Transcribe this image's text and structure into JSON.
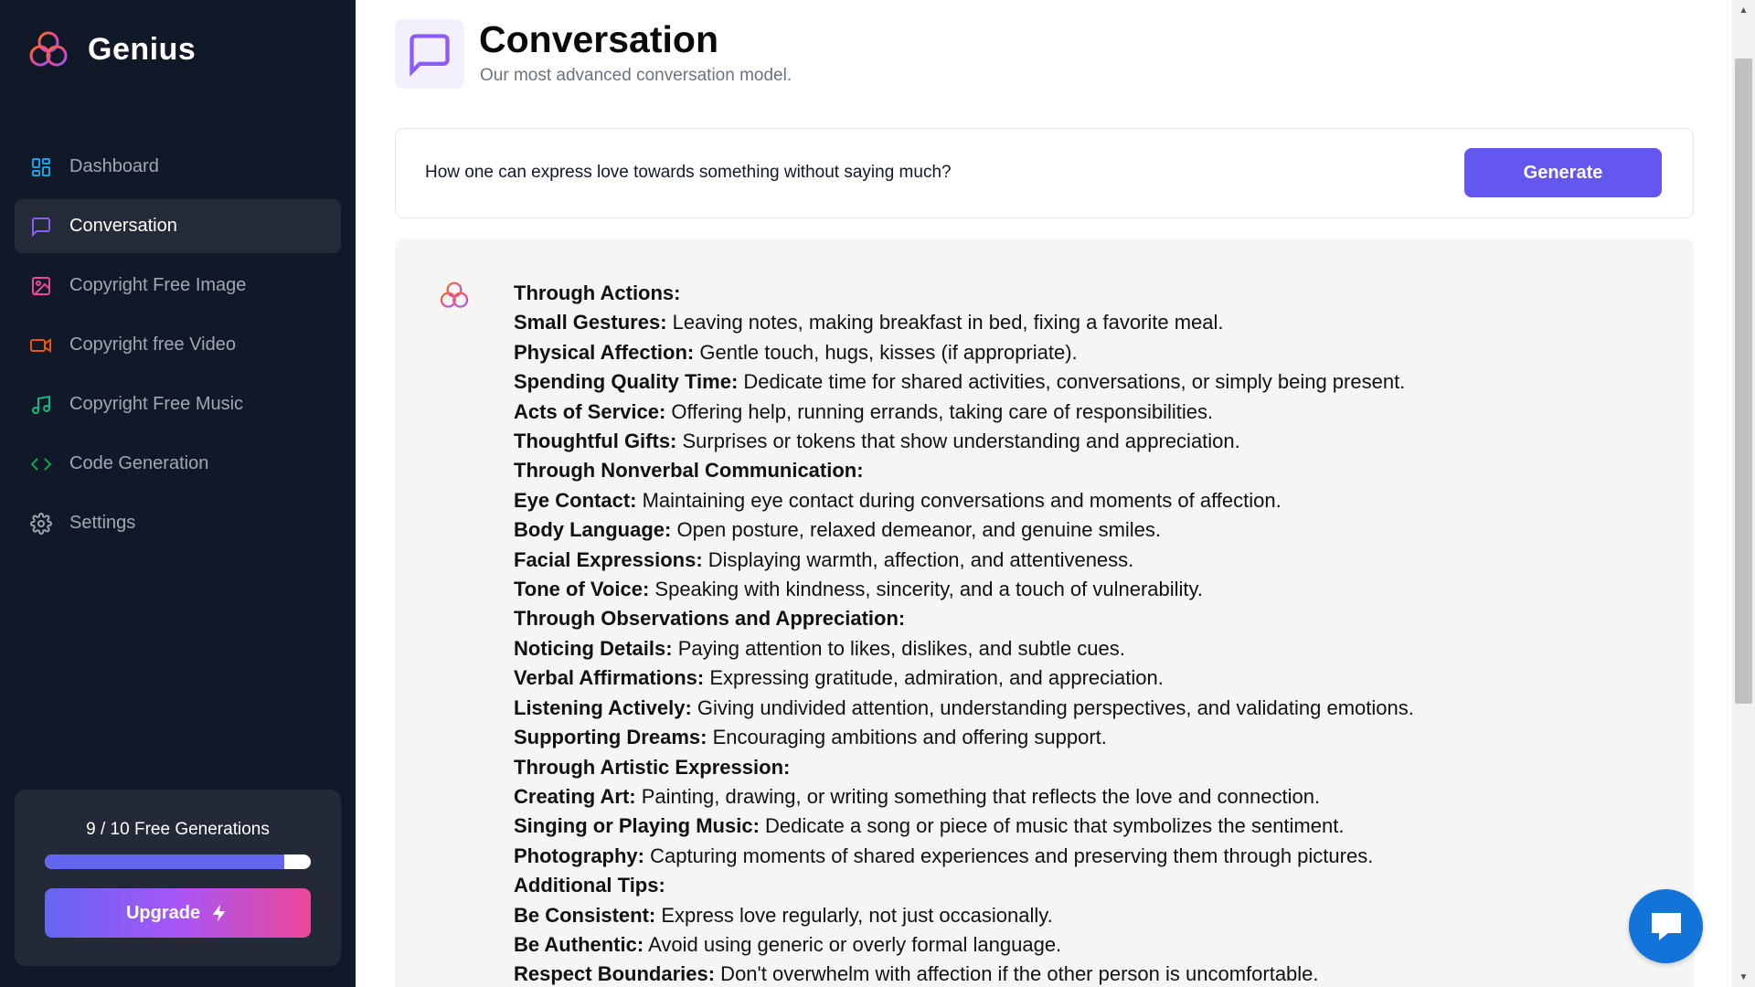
{
  "brand": {
    "name": "Genius",
    "logo_icon": "genius-rings-logo"
  },
  "sidebar": {
    "items": [
      {
        "label": "Dashboard",
        "icon": "dashboard-grid-icon",
        "color": "#0ea5e9",
        "active": false
      },
      {
        "label": "Conversation",
        "icon": "message-square-icon",
        "color": "#8b5cf6",
        "active": true
      },
      {
        "label": "Copyright Free Image",
        "icon": "image-icon",
        "color": "#ec4899",
        "active": false
      },
      {
        "label": "Copyright free Video",
        "icon": "video-icon",
        "color": "#ea580c",
        "active": false
      },
      {
        "label": "Copyright Free Music",
        "icon": "music-icon",
        "color": "#10b981",
        "active": false
      },
      {
        "label": "Code Generation",
        "icon": "code-icon",
        "color": "#16a34a",
        "active": false
      },
      {
        "label": "Settings",
        "icon": "gear-icon",
        "color": "#9ca3af",
        "active": false
      }
    ],
    "usage": {
      "text": "9 / 10 Free Generations",
      "used": 9,
      "limit": 10
    },
    "upgrade_label": "Upgrade"
  },
  "header": {
    "title": "Conversation",
    "subtitle": "Our most advanced conversation model.",
    "accent": "#8b5cf6"
  },
  "prompt": {
    "value": "How one can express love towards something without saying much?",
    "generate_label": "Generate",
    "button_color": "#6457f0"
  },
  "response": {
    "lines": [
      {
        "bold": "Through Actions:",
        "text": ""
      },
      {
        "bold": "Small Gestures:",
        "text": " Leaving notes, making breakfast in bed, fixing a favorite meal."
      },
      {
        "bold": "Physical Affection:",
        "text": " Gentle touch, hugs, kisses (if appropriate)."
      },
      {
        "bold": "Spending Quality Time:",
        "text": " Dedicate time for shared activities, conversations, or simply being present."
      },
      {
        "bold": "Acts of Service:",
        "text": " Offering help, running errands, taking care of responsibilities."
      },
      {
        "bold": "Thoughtful Gifts:",
        "text": " Surprises or tokens that show understanding and appreciation."
      },
      {
        "bold": "Through Nonverbal Communication:",
        "text": ""
      },
      {
        "bold": "Eye Contact:",
        "text": " Maintaining eye contact during conversations and moments of affection."
      },
      {
        "bold": "Body Language:",
        "text": " Open posture, relaxed demeanor, and genuine smiles."
      },
      {
        "bold": "Facial Expressions:",
        "text": " Displaying warmth, affection, and attentiveness."
      },
      {
        "bold": "Tone of Voice:",
        "text": " Speaking with kindness, sincerity, and a touch of vulnerability."
      },
      {
        "bold": "Through Observations and Appreciation:",
        "text": ""
      },
      {
        "bold": "Noticing Details:",
        "text": " Paying attention to likes, dislikes, and subtle cues."
      },
      {
        "bold": "Verbal Affirmations:",
        "text": " Expressing gratitude, admiration, and appreciation."
      },
      {
        "bold": "Listening Actively:",
        "text": " Giving undivided attention, understanding perspectives, and validating emotions."
      },
      {
        "bold": "Supporting Dreams:",
        "text": " Encouraging ambitions and offering support."
      },
      {
        "bold": "Through Artistic Expression:",
        "text": ""
      },
      {
        "bold": "Creating Art:",
        "text": " Painting, drawing, or writing something that reflects the love and connection."
      },
      {
        "bold": "Singing or Playing Music:",
        "text": " Dedicate a song or piece of music that symbolizes the sentiment."
      },
      {
        "bold": "Photography:",
        "text": " Capturing moments of shared experiences and preserving them through pictures."
      },
      {
        "bold": "Additional Tips:",
        "text": ""
      },
      {
        "bold": "Be Consistent:",
        "text": " Express love regularly, not just occasionally."
      },
      {
        "bold": "Be Authentic:",
        "text": " Avoid using generic or overly formal language."
      },
      {
        "bold": "Respect Boundaries:",
        "text": " Don't overwhelm with affection if the other person is uncomfortable."
      }
    ]
  },
  "chat_widget": {
    "icon": "chat-bubble-icon",
    "color": "#1273d8"
  }
}
